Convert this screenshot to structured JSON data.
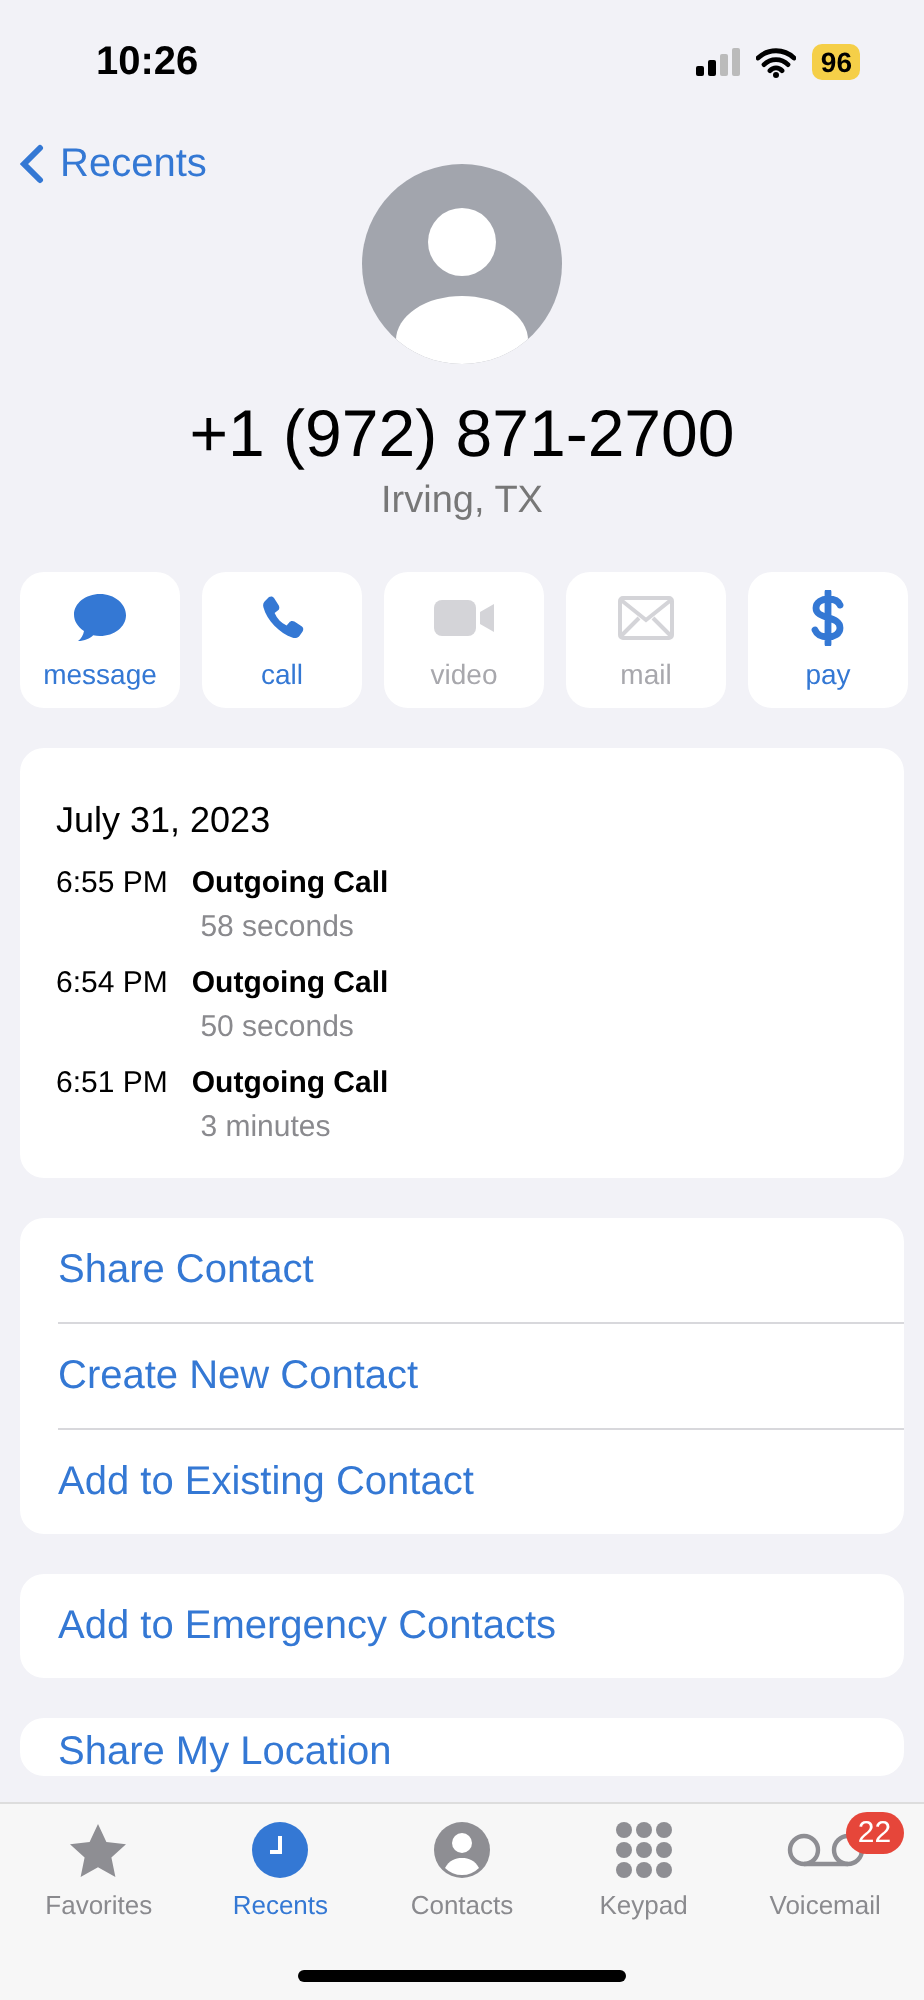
{
  "status_bar": {
    "time": "10:26",
    "battery": "96"
  },
  "nav": {
    "back_label": "Recents"
  },
  "contact": {
    "number": "+1 (972) 871-2700",
    "location": "Irving, TX"
  },
  "actions": [
    {
      "kind": "message",
      "label": "message",
      "disabled": false
    },
    {
      "kind": "call",
      "label": "call",
      "disabled": false
    },
    {
      "kind": "video",
      "label": "video",
      "disabled": true
    },
    {
      "kind": "mail",
      "label": "mail",
      "disabled": true
    },
    {
      "kind": "pay",
      "label": "pay",
      "disabled": false
    }
  ],
  "call_history": {
    "date": "July 31, 2023",
    "calls": [
      {
        "time": "6:55 PM",
        "type": "Outgoing Call",
        "duration": "58 seconds"
      },
      {
        "time": "6:54 PM",
        "type": "Outgoing Call",
        "duration": "50 seconds"
      },
      {
        "time": "6:51 PM",
        "type": "Outgoing Call",
        "duration": "3 minutes"
      }
    ]
  },
  "option_groups": [
    [
      "Share Contact",
      "Create New Contact",
      "Add to Existing Contact"
    ],
    [
      "Add to Emergency Contacts"
    ],
    [
      "Share My Location"
    ]
  ],
  "tab_bar": [
    {
      "kind": "favorites",
      "label": "Favorites",
      "selected": false
    },
    {
      "kind": "recents",
      "label": "Recents",
      "selected": true
    },
    {
      "kind": "contacts",
      "label": "Contacts",
      "selected": false
    },
    {
      "kind": "keypad",
      "label": "Keypad",
      "selected": false
    },
    {
      "kind": "voicemail",
      "label": "Voicemail",
      "selected": false,
      "badge": "22"
    }
  ]
}
